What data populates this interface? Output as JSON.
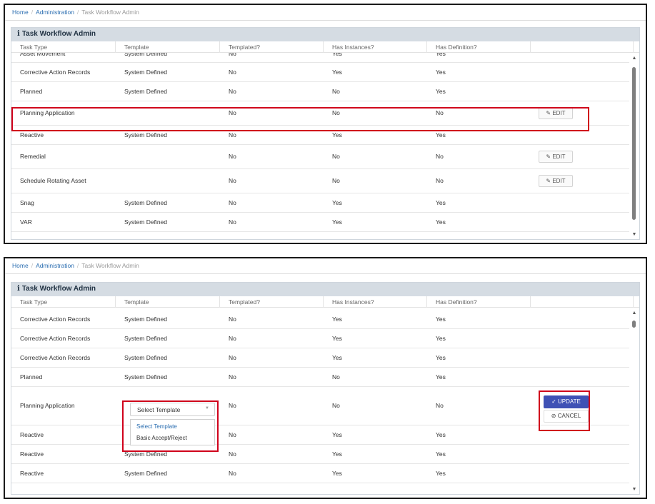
{
  "breadcrumb": {
    "home": "Home",
    "admin": "Administration",
    "current": "Task Workflow Admin",
    "sep": "/"
  },
  "panel": {
    "title": "Task Workflow Admin",
    "info_icon": "i"
  },
  "columns": [
    "Task Type",
    "Template",
    "Templated?",
    "Has Instances?",
    "Has Definition?"
  ],
  "icons": {
    "edit": "pencil-icon",
    "update": "check-icon",
    "cancel": "cancel-circle-icon",
    "caret": "caret-down-icon"
  },
  "colors": {
    "highlight": "#d0021b",
    "primary_button": "#3f51b5",
    "link": "#2a6db0",
    "header_bg": "#d5dce3"
  },
  "top_table": {
    "rows": [
      {
        "type": "Asset Movement",
        "template": "System Defined",
        "templated": "No",
        "instances": "Yes",
        "definition": "Yes",
        "action": ""
      },
      {
        "type": "Corrective Action Records",
        "template": "System Defined",
        "templated": "No",
        "instances": "Yes",
        "definition": "Yes",
        "action": ""
      },
      {
        "type": "Planned",
        "template": "System Defined",
        "templated": "No",
        "instances": "No",
        "definition": "Yes",
        "action": ""
      },
      {
        "type": "Planning Application",
        "template": "",
        "templated": "No",
        "instances": "No",
        "definition": "No",
        "action": "EDIT"
      },
      {
        "type": "Reactive",
        "template": "System Defined",
        "templated": "No",
        "instances": "Yes",
        "definition": "Yes",
        "action": ""
      },
      {
        "type": "Remedial",
        "template": "",
        "templated": "No",
        "instances": "No",
        "definition": "No",
        "action": "EDIT"
      },
      {
        "type": "Schedule Rotating Asset",
        "template": "",
        "templated": "No",
        "instances": "No",
        "definition": "No",
        "action": "EDIT"
      },
      {
        "type": "Snag",
        "template": "System Defined",
        "templated": "No",
        "instances": "Yes",
        "definition": "Yes",
        "action": ""
      },
      {
        "type": "VAR",
        "template": "System Defined",
        "templated": "No",
        "instances": "Yes",
        "definition": "Yes",
        "action": ""
      }
    ]
  },
  "bottom_table": {
    "rows": [
      {
        "type": "Corrective Action Records",
        "template": "System Defined",
        "templated": "No",
        "instances": "Yes",
        "definition": "Yes"
      },
      {
        "type": "Corrective Action Records",
        "template": "System Defined",
        "templated": "No",
        "instances": "Yes",
        "definition": "Yes"
      },
      {
        "type": "Corrective Action Records",
        "template": "System Defined",
        "templated": "No",
        "instances": "Yes",
        "definition": "Yes"
      },
      {
        "type": "Planned",
        "template": "System Defined",
        "templated": "No",
        "instances": "No",
        "definition": "Yes"
      },
      {
        "type": "Planning Application",
        "template": "",
        "templated": "No",
        "instances": "No",
        "definition": "No"
      },
      {
        "type": "Reactive",
        "template": "",
        "templated": "No",
        "instances": "Yes",
        "definition": "Yes"
      },
      {
        "type": "Reactive",
        "template": "System Defined",
        "templated": "No",
        "instances": "Yes",
        "definition": "Yes"
      },
      {
        "type": "Reactive",
        "template": "System Defined",
        "templated": "No",
        "instances": "Yes",
        "definition": "Yes"
      }
    ],
    "select": {
      "value": "Select Template",
      "options": [
        "Select Template",
        "Basic Accept/Reject"
      ]
    },
    "update_label": "UPDATE",
    "cancel_label": "CANCEL"
  }
}
